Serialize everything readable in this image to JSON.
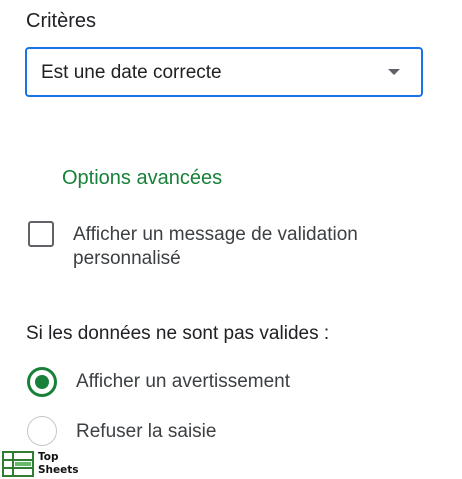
{
  "criteria": {
    "label": "Critères",
    "selected_value": "Est une date correcte"
  },
  "advanced": {
    "label": "Options avancées",
    "custom_message_checkbox": {
      "label_line1": "Afficher un message de validation",
      "label_line2": "personnalisé",
      "checked": false
    }
  },
  "invalid_data": {
    "label": "Si les données ne sont pas valides :",
    "options": [
      {
        "label": "Afficher un avertissement",
        "selected": true
      },
      {
        "label": "Refuser la saisie",
        "selected": false
      }
    ]
  },
  "watermark": {
    "line1": "Top",
    "line2": "Sheets"
  },
  "colors": {
    "accent_blue": "#1a73e8",
    "accent_green": "#188038"
  },
  "icons": {
    "dropdown": "chevron-down-icon",
    "logo": "sheets-logo-icon"
  }
}
